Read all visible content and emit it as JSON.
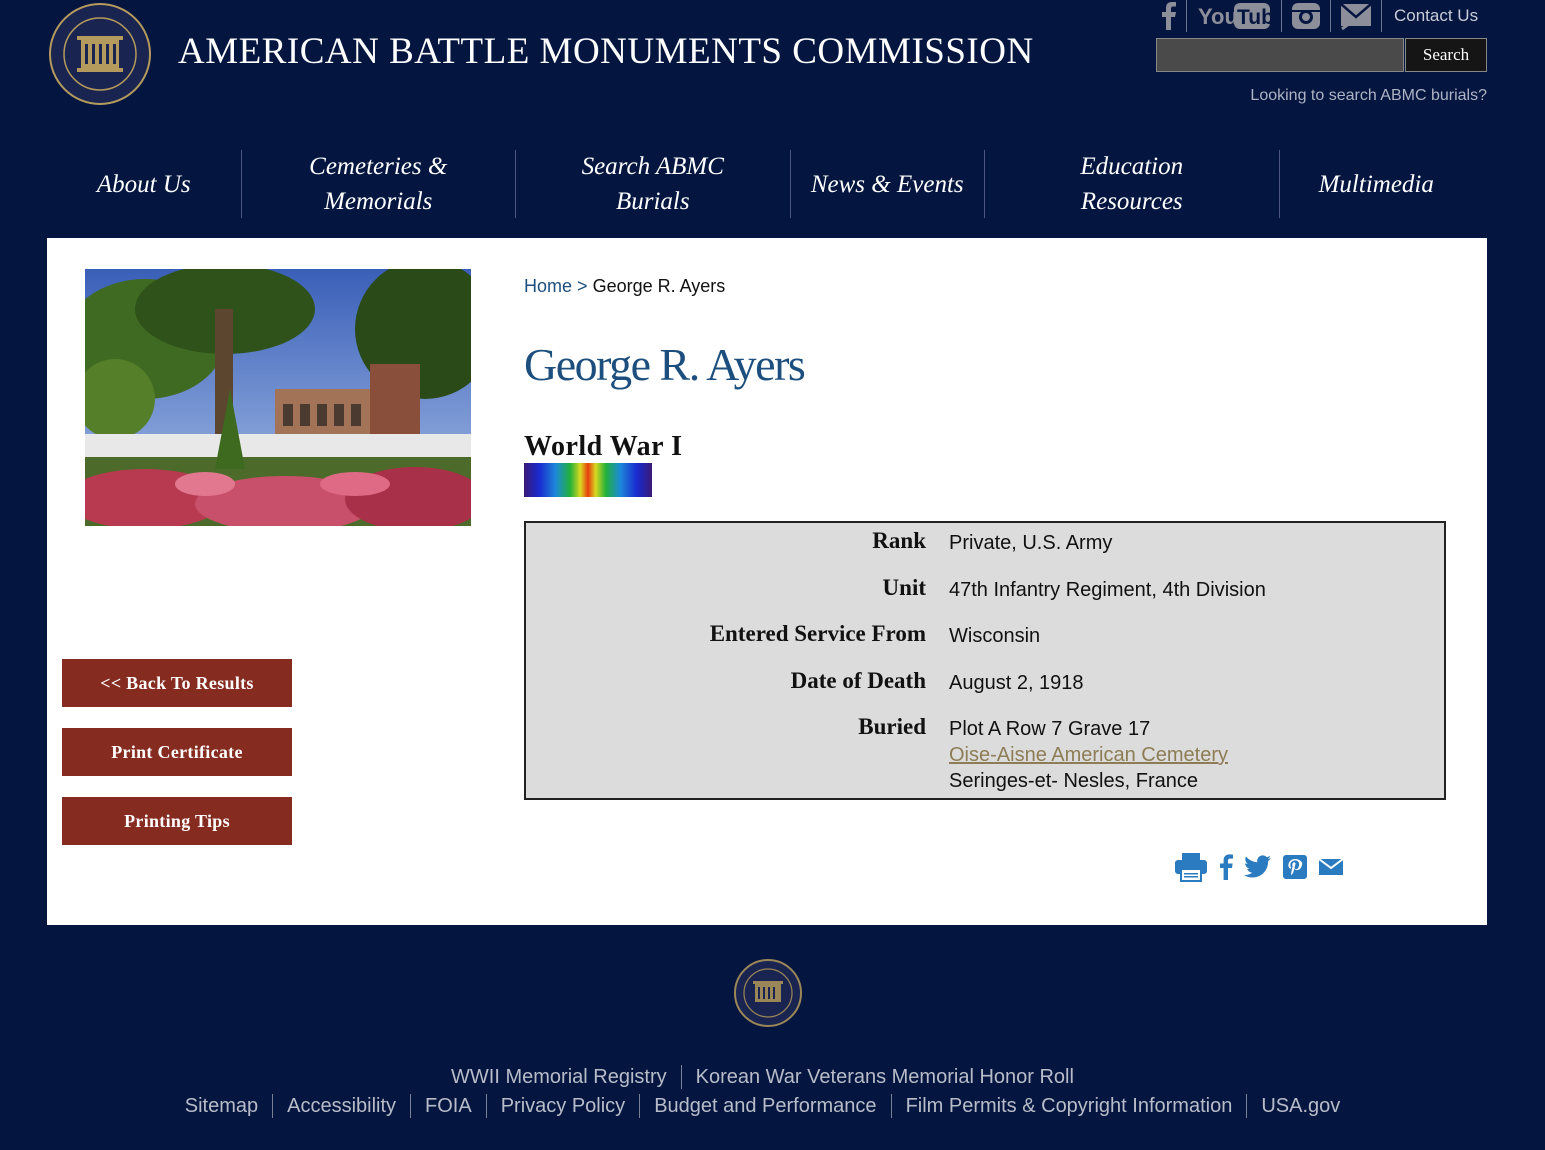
{
  "header": {
    "site_title": "AMERICAN BATTLE MONUMENTS COMMISSION",
    "contact_label": "Contact Us",
    "search_button": "Search",
    "search_placeholder": "",
    "burial_search_link": "Looking to search ABMC burials?"
  },
  "nav": [
    "About Us",
    "Cemeteries & Memorials",
    "Search ABMC Burials",
    "News & Events",
    "Education Resources",
    "Multimedia"
  ],
  "sidebar": {
    "back_button": "<< Back To Results",
    "print_button": "Print Certificate",
    "tips_button": "Printing Tips"
  },
  "breadcrumb": {
    "home": "Home",
    "separator": ">",
    "current": "George R. Ayers"
  },
  "person": {
    "name": "George R. Ayers",
    "war": "World War I"
  },
  "details": {
    "rank_label": "Rank",
    "rank_value": "Private, U.S. Army",
    "unit_label": "Unit",
    "unit_value": "47th Infantry Regiment, 4th Division",
    "service_label": "Entered Service From",
    "service_value": "Wisconsin",
    "death_label": "Date of Death",
    "death_value": "August 2, 1918",
    "buried_label": "Buried",
    "buried_plot": "Plot A Row 7 Grave 17",
    "buried_cemetery": "Oise-Aisne American Cemetery",
    "buried_location": "Seringes-et- Nesles, France"
  },
  "footer": {
    "row1": [
      "WWII Memorial Registry",
      "Korean War Veterans Memorial Honor Roll"
    ],
    "row2": [
      "Sitemap",
      "Accessibility",
      "FOIA",
      "Privacy Policy",
      "Budget and Performance",
      "Film Permits & Copyright Information",
      "USA.gov"
    ]
  },
  "colors": {
    "background": "#041640",
    "title_blue": "#1c4f7e",
    "button_red": "#862b20",
    "panel_gray": "#dcdcdc",
    "link_gold": "#8d7d55"
  },
  "icons": [
    "facebook-icon",
    "youtube-icon",
    "instagram-icon",
    "mail-icon",
    "print-icon",
    "twitter-icon",
    "pinterest-icon"
  ]
}
